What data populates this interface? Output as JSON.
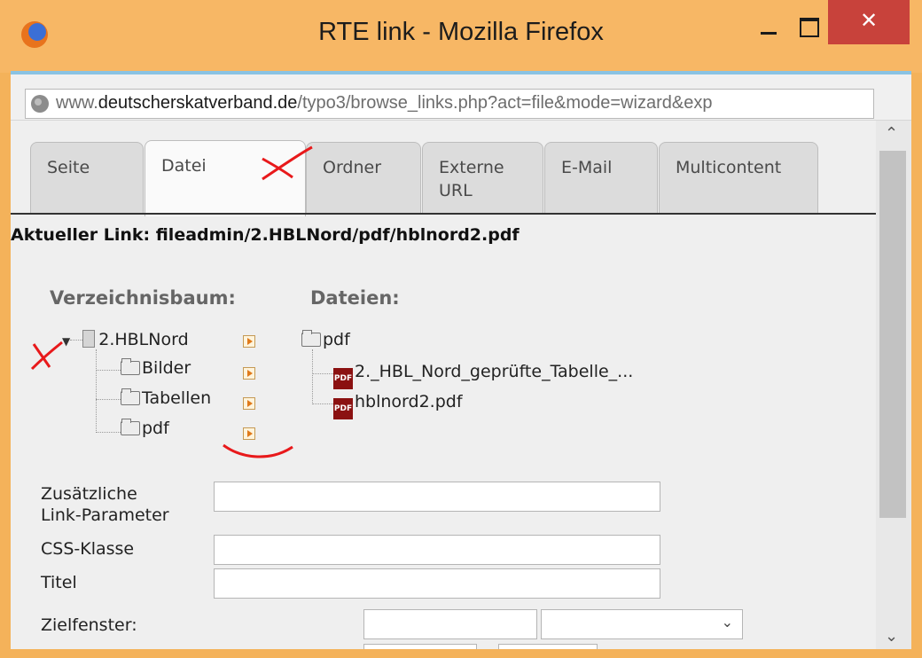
{
  "window": {
    "title": "RTE link - Mozilla Firefox",
    "close_glyph": "✕",
    "icons": [
      "firefox-icon",
      "minimize-icon",
      "maximize-icon",
      "close-icon"
    ]
  },
  "urlbar": {
    "prefix": "www.",
    "domain": "deutscherskatverband.de",
    "path": "/typo3/browse_links.php?act=file&mode=wizard&exp"
  },
  "tabs": [
    {
      "label": "Seite"
    },
    {
      "label": "Datei"
    },
    {
      "label": "Ordner"
    },
    {
      "label": "Externe URL"
    },
    {
      "label": "E-Mail"
    },
    {
      "label": "Multicontent"
    }
  ],
  "current_link": "Aktueller Link: fileadmin/2.HBLNord/pdf/hblnord2.pdf",
  "tree": {
    "heading": "Verzeichnisbaum:",
    "root": "2.HBLNord",
    "children": [
      "Bilder",
      "Tabellen",
      "pdf"
    ]
  },
  "files": {
    "heading": "Dateien:",
    "folder": "pdf",
    "items": [
      "2._HBL_Nord_geprüfte_Tabelle_...",
      "hblnord2.pdf"
    ]
  },
  "form": {
    "params_label_1": "Zusätzliche",
    "params_label_2": "Link-Parameter",
    "css_label": "CSS-Klasse",
    "title_label": "Titel",
    "target_label": "Zielfenster:"
  },
  "colors": {
    "titlebar": "#f7b765",
    "close_button": "#c8423b",
    "annotation_red": "#e8191b"
  }
}
